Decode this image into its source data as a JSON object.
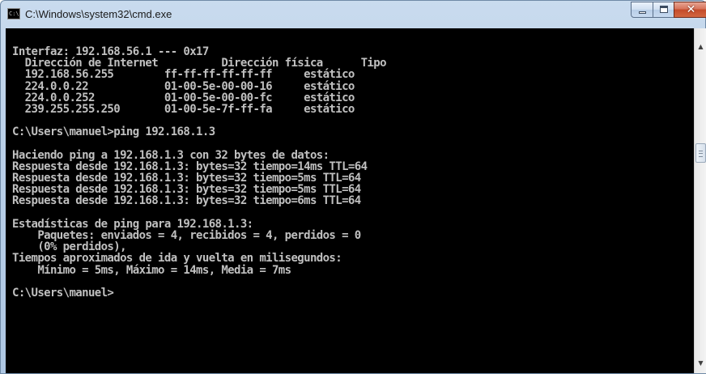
{
  "window": {
    "title": "C:\\Windows\\system32\\cmd.exe",
    "icon": "cmd-icon",
    "icon_text": "C:\\",
    "controls": {
      "minimize": "minimize-icon",
      "maximize": "maximize-icon",
      "close": "close-icon",
      "close_glyph": "✕"
    }
  },
  "console": {
    "background": "#000000",
    "foreground": "#c0c0c0",
    "lines": [
      "Interfaz: 192.168.56.1 --- 0x17",
      "  Dirección de Internet          Dirección física      Tipo",
      "  192.168.56.255        ff-ff-ff-ff-ff-ff     estático",
      "  224.0.0.22            01-00-5e-00-00-16     estático",
      "  224.0.0.252           01-00-5e-00-00-fc     estático",
      "  239.255.255.250       01-00-5e-7f-ff-fa     estático",
      "",
      "C:\\Users\\manuel>ping 192.168.1.3",
      "",
      "Haciendo ping a 192.168.1.3 con 32 bytes de datos:",
      "Respuesta desde 192.168.1.3: bytes=32 tiempo=14ms TTL=64",
      "Respuesta desde 192.168.1.3: bytes=32 tiempo=5ms TTL=64",
      "Respuesta desde 192.168.1.3: bytes=32 tiempo=5ms TTL=64",
      "Respuesta desde 192.168.1.3: bytes=32 tiempo=6ms TTL=64",
      "",
      "Estadísticas de ping para 192.168.1.3:",
      "    Paquetes: enviados = 4, recibidos = 4, perdidos = 0",
      "    (0% perdidos),",
      "Tiempos aproximados de ida y vuelta en milisegundos:",
      "    Mínimo = 5ms, Máximo = 14ms, Media = 7ms",
      "",
      "C:\\Users\\manuel>"
    ]
  },
  "scrollbar": {
    "up_arrow": "▲",
    "down_arrow": "▼",
    "up_icon": "scroll-up-arrow-icon",
    "down_icon": "scroll-down-arrow-icon"
  }
}
